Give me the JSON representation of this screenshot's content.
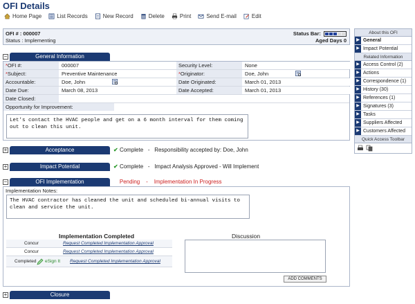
{
  "title": "OFI Details",
  "toolbar": [
    {
      "label": "Home Page"
    },
    {
      "label": "List Records"
    },
    {
      "label": "New Record"
    },
    {
      "label": "Delete"
    },
    {
      "label": "Print"
    },
    {
      "label": "Send E-mail"
    },
    {
      "label": "Edit"
    }
  ],
  "header": {
    "ofi_label": "OFI # : 000007",
    "status_label": "Status : Implementing",
    "status_bar_label": "Status Bar:",
    "aged_days_label": "Aged Days",
    "aged_days_value": "0",
    "status_progress": 0.6
  },
  "sections": {
    "general": "General Information",
    "acceptance": "Acceptance",
    "impact": "Impact Potential",
    "implementation": "OFI Implementation",
    "closure": "Closure"
  },
  "general": {
    "ofi_num_label": "OFI #:",
    "ofi_num_value": "000007",
    "security_label": "Security Level:",
    "security_value": "None",
    "subject_label": "Subject:",
    "subject_value": "Preventive Maintenance",
    "originator_label": "Originator:",
    "originator_value": "Doe, John",
    "accountable_label": "Accountable:",
    "accountable_value": "Doe, John",
    "date_originated_label": "Date Originated:",
    "date_originated_value": "March 01, 2013",
    "date_due_label": "Date Due:",
    "date_due_value": "March 08, 2013",
    "date_accepted_label": "Date Accepted:",
    "date_accepted_value": "March 01, 2013",
    "date_closed_label": "Date Closed:",
    "date_closed_value": "",
    "opportunity_label": "Opportunity for Improvement:",
    "opportunity_text": "Let's contact the HVAC people and get on a 6 month interval for them coming out to clean this unit."
  },
  "acceptance": {
    "status": "Complete",
    "detail": "Responsibility accepted by: Doe, John"
  },
  "impact": {
    "status": "Complete",
    "detail": "Impact Analysis Approved - Will Implement"
  },
  "implementation": {
    "status": "Pending",
    "detail": "Implementation In Progress",
    "notes_label": "Implementation Notes:",
    "notes_text": "The HVAC contractor has cleaned the unit and scheduled bi-annual visits to clean and service the unit.",
    "completed_title": "Implementation Completed",
    "rows": [
      {
        "step": "Concur",
        "link": "Request Completed Implementation Approval"
      },
      {
        "step": "Concur",
        "link": "Request Completed Implementation Approval"
      },
      {
        "step": "Completed",
        "esign": "eSign It",
        "link": "Request Completed Implementation Approval"
      }
    ],
    "discussion_title": "Discussion",
    "add_comments": "ADD COMMENTS"
  },
  "sidebar": {
    "about_header": "About this OFI",
    "about_items": [
      "General",
      "Impact Potential"
    ],
    "related_header": "Related Information",
    "related_items": [
      "Access Control (2)",
      "Actions",
      "Correspondence (1)",
      "History (30)",
      "References (1)",
      "Signatures (3)",
      "Tasks",
      "Suppliers Affected",
      "Customers Affected"
    ],
    "quick_header": "Quick Access Toolbar"
  },
  "colors": {
    "brand": "#1b3a73",
    "complete": "#2c9a2c",
    "pending": "#cc2020"
  }
}
